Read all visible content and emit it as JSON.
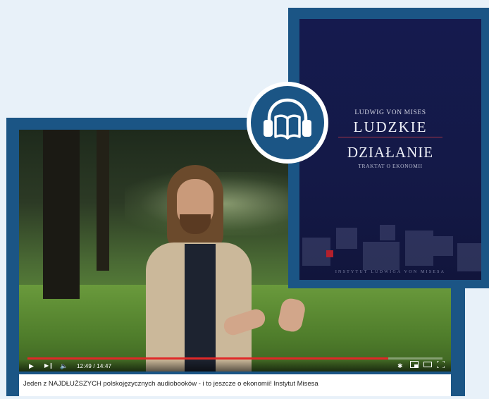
{
  "video": {
    "time": "12:49 / 14:47",
    "progress_fraction": 0.87,
    "caption": "Jeden z NAJDŁUŻSZYCH polskojęzycznych audiobooków - i to jeszcze o ekonomii! Instytut Misesa"
  },
  "book": {
    "author": "LUDWIG VON MISES",
    "title_line1": "LUDZKIE",
    "title_line2": "DZIAŁANIE",
    "subtitle": "TRAKTAT O EKONOMII",
    "publisher": "INSTYTUT LUDWIGA VON MISESA"
  },
  "icons": {
    "badge": "headphones-book-icon",
    "play": "play-icon",
    "next": "next-icon",
    "volume": "volume-icon",
    "settings": "settings-gear-icon",
    "miniplayer": "miniplayer-icon",
    "theater": "theater-mode-icon",
    "fullscreen": "fullscreen-icon"
  },
  "colors": {
    "frame": "#1b5585",
    "progress": "#e02828",
    "cover": "#151a4e"
  }
}
